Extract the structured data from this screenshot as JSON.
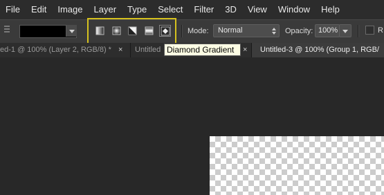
{
  "menu": [
    "File",
    "Edit",
    "Image",
    "Layer",
    "Type",
    "Select",
    "Filter",
    "3D",
    "View",
    "Window",
    "Help"
  ],
  "options": {
    "gradient_types": [
      {
        "name": "linear",
        "icon": "linear-gradient-icon"
      },
      {
        "name": "radial",
        "icon": "radial-gradient-icon"
      },
      {
        "name": "angle",
        "icon": "angle-gradient-icon"
      },
      {
        "name": "reflected",
        "icon": "reflected-gradient-icon"
      },
      {
        "name": "diamond",
        "icon": "diamond-gradient-icon"
      }
    ],
    "active_gradient": "diamond",
    "mode_label": "Mode:",
    "mode_value": "Normal",
    "opacity_label": "Opacity:",
    "opacity_value": "100%",
    "reverse_label": "R",
    "highlight_color": "#d6c21e"
  },
  "tabs": [
    {
      "label": "ed-1 @ 100% (Layer 2, RGB/8) *",
      "close": "×",
      "active": false
    },
    {
      "label": "Untitled",
      "close": "×",
      "active": false
    },
    {
      "label": "Untitled-3 @ 100% (Group 1, RGB/",
      "close": "×",
      "active": true
    }
  ],
  "tooltip": "Diamond Gradient"
}
